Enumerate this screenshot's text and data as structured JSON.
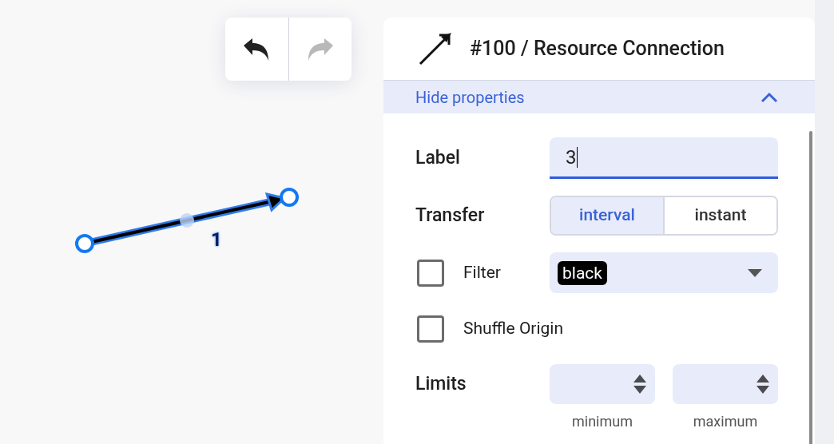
{
  "toolbar": [
    {
      "kind": "undo",
      "disabled": false
    },
    {
      "kind": "redo",
      "disabled": true
    }
  ],
  "canvas": {
    "edge_label": "1",
    "selected": true
  },
  "panel": {
    "title": "#100 / Resource Connection",
    "toggle": "Hide properties",
    "expanded": true,
    "label_field": {
      "label": "Label",
      "value": "3"
    },
    "transfer": {
      "label": "Transfer",
      "options": [
        {
          "label": "interval",
          "selected": true
        },
        {
          "label": "instant",
          "selected": false
        }
      ]
    },
    "filter": {
      "label": "Filter",
      "checked": false,
      "value": "black"
    },
    "shuffle_origin": {
      "label": "Shuffle Origin",
      "checked": false
    },
    "limits": {
      "label": "Limits",
      "fields": [
        {
          "caption": "minimum"
        },
        {
          "caption": "maximum"
        }
      ]
    }
  }
}
